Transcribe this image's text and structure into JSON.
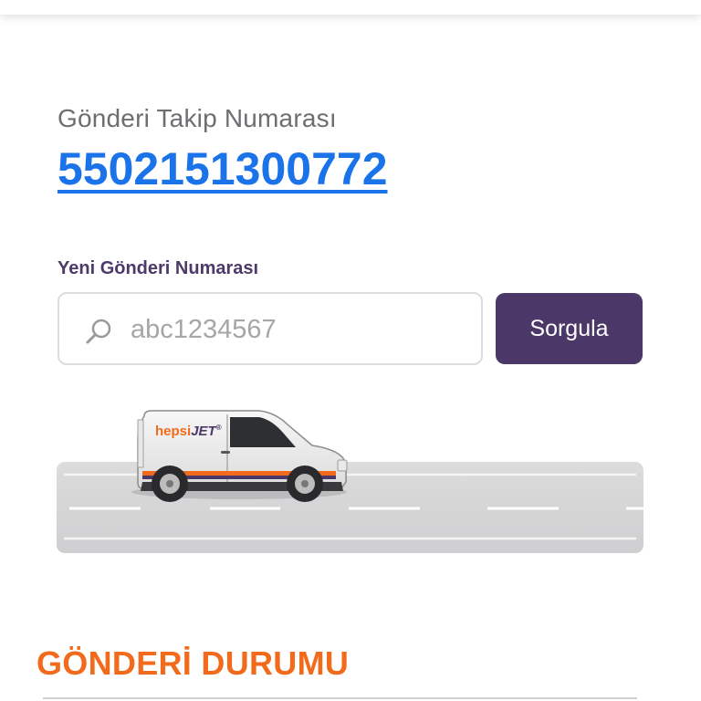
{
  "tracking": {
    "label": "Gönderi Takip Numarası",
    "number": "5502151300772"
  },
  "search": {
    "label": "Yeni Gönderi Numarası",
    "placeholder": "abc1234567",
    "value": "",
    "icon": "search-icon",
    "button_label": "Sorgula"
  },
  "illustration": {
    "van_brand_prefix": "hepsi",
    "van_brand_suffix": "JET",
    "van_brand_mark": "®"
  },
  "status": {
    "title": "GÖNDERİ DURUMU"
  },
  "colors": {
    "link_blue": "#1a73e8",
    "brand_purple": "#4b3768",
    "brand_orange": "#f26a1b",
    "road_gray": "#d2d2d4"
  }
}
